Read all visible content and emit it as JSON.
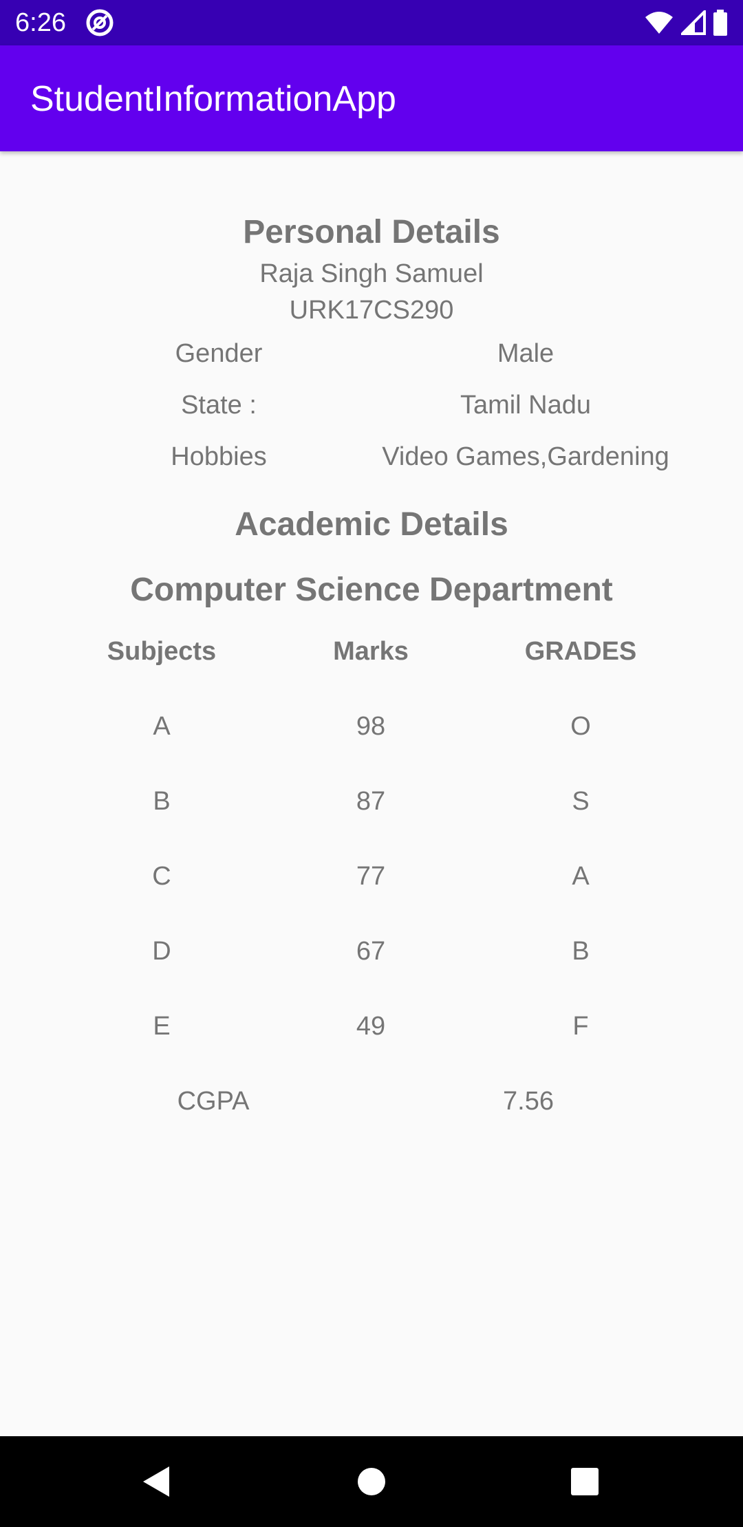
{
  "status_bar": {
    "time": "6:26",
    "icons": [
      "at-sign-icon",
      "wifi-icon",
      "cellular-signal-icon",
      "battery-icon"
    ]
  },
  "app_bar": {
    "title": "StudentInformationApp",
    "color": "#6200ee"
  },
  "personal": {
    "heading": "Personal Details",
    "name": "Raja Singh Samuel",
    "reg_no": "URK17CS290",
    "rows": [
      {
        "label": "Gender",
        "value": "Male"
      },
      {
        "label": "State :",
        "value": "Tamil Nadu"
      },
      {
        "label": "Hobbies",
        "value": "Video Games,Gardening"
      }
    ]
  },
  "academic": {
    "heading": "Academic Details",
    "department": "Computer Science Department",
    "columns": [
      "Subjects",
      "Marks",
      "GRADES"
    ],
    "rows": [
      {
        "subject": "A",
        "marks": "98",
        "grade": "O"
      },
      {
        "subject": "B",
        "marks": "87",
        "grade": "S"
      },
      {
        "subject": "C",
        "marks": "77",
        "grade": "A"
      },
      {
        "subject": "D",
        "marks": "67",
        "grade": "B"
      },
      {
        "subject": "E",
        "marks": "49",
        "grade": "F"
      }
    ],
    "cgpa_label": "CGPA",
    "cgpa_value": "7.56"
  },
  "nav_bar": {
    "icons": [
      "back-icon",
      "home-icon",
      "recents-icon"
    ]
  }
}
